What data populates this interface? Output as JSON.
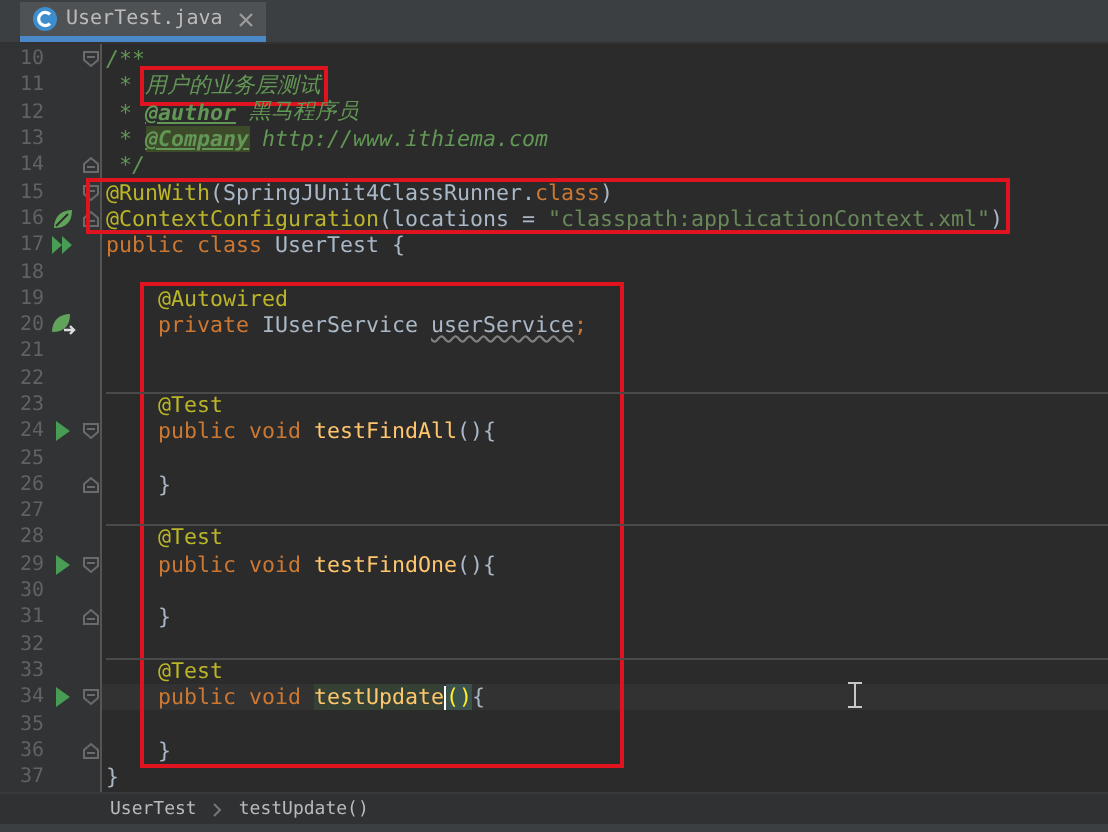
{
  "tab": {
    "label": "UserTest.java",
    "selected": true
  },
  "code_lines": [
    {
      "kind": "line",
      "number": "10",
      "fold": {
        "kind": "start"
      },
      "tokens": [
        {
          "t": "/**",
          "kind": "doc"
        }
      ]
    },
    {
      "kind": "line",
      "number": "11",
      "tokens": [
        {
          "t": " *",
          "kind": "doc"
        },
        {
          "t": "用户的业务层测试",
          "kind": "doc",
          "boxed": true
        }
      ]
    },
    {
      "kind": "line",
      "number": "12",
      "tokens": [
        {
          "t": " *",
          "kind": "doc"
        },
        {
          "t": "@author",
          "kind": "doctag"
        },
        {
          "t": "黑马程序员",
          "kind": "doc"
        }
      ]
    },
    {
      "kind": "line",
      "number": "13",
      "tokens": [
        {
          "t": " *",
          "kind": "doc"
        },
        {
          "t": "@Company",
          "kind": "doctag-bad"
        },
        {
          "t": "http://www.ithiema.com",
          "kind": "doc-italic"
        }
      ]
    },
    {
      "kind": "line",
      "number": "14",
      "fold": {
        "kind": "end"
      },
      "tokens": [
        {
          "t": " */",
          "kind": "doc"
        }
      ]
    },
    {
      "kind": "boxed",
      "box": {
        "kind": "wide"
      },
      "lines": [
        {
          "kind": "line",
          "number": "15",
          "fold": {
            "kind": "start"
          },
          "tokens": [
            {
              "t": "@RunWith",
              "kind": "ann"
            },
            {
              "t": "(SpringJUnit4ClassRunner.",
              "kind": "plain"
            },
            {
              "t": "class",
              "kind": "kw"
            },
            {
              "t": ")",
              "kind": "plain"
            }
          ]
        },
        {
          "kind": "line",
          "number": "16",
          "gutter": {
            "kind": "bean"
          },
          "fold": {
            "kind": "end"
          },
          "tokens": [
            {
              "t": "@ContextConfiguration",
              "kind": "ann"
            },
            {
              "t": "(locations = ",
              "kind": "plain"
            },
            {
              "t": "\"classpath:applicationContext.xml\"",
              "kind": "str"
            },
            {
              "t": ")",
              "kind": "plain"
            }
          ]
        }
      ]
    },
    {
      "kind": "line",
      "number": "17",
      "gutter": {
        "kind": "run-all"
      },
      "tokens": [
        {
          "t": "public class ",
          "kind": "kw"
        },
        {
          "t": "UserTest {",
          "kind": "plain"
        }
      ]
    },
    {
      "kind": "line",
      "number": "18"
    },
    {
      "kind": "boxed",
      "box": {
        "kind": "block"
      },
      "lines": [
        {
          "kind": "line",
          "number": "19",
          "tokens": [
            {
              "t": "    @Autowired",
              "kind": "ann"
            }
          ]
        },
        {
          "kind": "line",
          "number": "20",
          "gutter": {
            "kind": "bean-link"
          },
          "tokens": [
            {
              "t": "    private ",
              "kind": "kw"
            },
            {
              "t": "IUserService ",
              "kind": "plain"
            },
            {
              "t": "userService",
              "kind": "unused"
            },
            {
              "t": ";",
              "kind": "kw"
            }
          ]
        },
        {
          "kind": "line",
          "number": "21"
        },
        {
          "kind": "line",
          "number": "22"
        },
        {
          "kind": "line",
          "number": "23",
          "separator_above": true,
          "tokens": [
            {
              "t": "    @Test",
              "kind": "ann"
            }
          ]
        },
        {
          "kind": "line",
          "number": "24",
          "gutter": {
            "kind": "run"
          },
          "fold": {
            "kind": "start"
          },
          "tokens": [
            {
              "t": "    public void ",
              "kind": "kw"
            },
            {
              "t": "testFindAll",
              "kind": "method"
            },
            {
              "t": "(){",
              "kind": "plain"
            }
          ]
        },
        {
          "kind": "line",
          "number": "25"
        },
        {
          "kind": "line",
          "number": "26",
          "fold": {
            "kind": "end"
          },
          "tokens": [
            {
              "t": "    }",
              "kind": "plain"
            }
          ]
        },
        {
          "kind": "line",
          "number": "27"
        },
        {
          "kind": "line",
          "number": "28",
          "separator_above": true,
          "tokens": [
            {
              "t": "    @Test",
              "kind": "ann"
            }
          ]
        },
        {
          "kind": "line",
          "number": "29",
          "gutter": {
            "kind": "run"
          },
          "fold": {
            "kind": "start"
          },
          "tokens": [
            {
              "t": "    public void ",
              "kind": "kw"
            },
            {
              "t": "testFindOne",
              "kind": "method"
            },
            {
              "t": "(){",
              "kind": "plain"
            }
          ]
        },
        {
          "kind": "line",
          "number": "30"
        },
        {
          "kind": "line",
          "number": "31",
          "fold": {
            "kind": "end"
          },
          "tokens": [
            {
              "t": "    }",
              "kind": "plain"
            }
          ]
        },
        {
          "kind": "line",
          "number": "32"
        },
        {
          "kind": "line",
          "number": "33",
          "separator_above": true,
          "tokens": [
            {
              "t": "    @Test",
              "kind": "ann"
            }
          ]
        },
        {
          "kind": "line",
          "number": "34",
          "gutter": {
            "kind": "run"
          },
          "fold": {
            "kind": "start"
          },
          "current": true,
          "tokens": [
            {
              "t": "    public void ",
              "kind": "kw"
            },
            {
              "t": "testUpdate",
              "kind": "method-hl",
              "caret_after": true
            },
            {
              "t": "()",
              "kind": "brace-match"
            },
            {
              "t": "{",
              "kind": "plain"
            }
          ]
        },
        {
          "kind": "line",
          "number": "35"
        },
        {
          "kind": "line",
          "number": "36",
          "fold": {
            "kind": "end"
          },
          "tokens": [
            {
              "t": "    }",
              "kind": "plain"
            }
          ]
        }
      ]
    },
    {
      "kind": "line",
      "number": "37",
      "tokens": [
        {
          "t": "}",
          "kind": "plain"
        }
      ]
    }
  ],
  "breadcrumbs": [
    {
      "label": "UserTest"
    },
    {
      "label": "testUpdate()"
    }
  ]
}
